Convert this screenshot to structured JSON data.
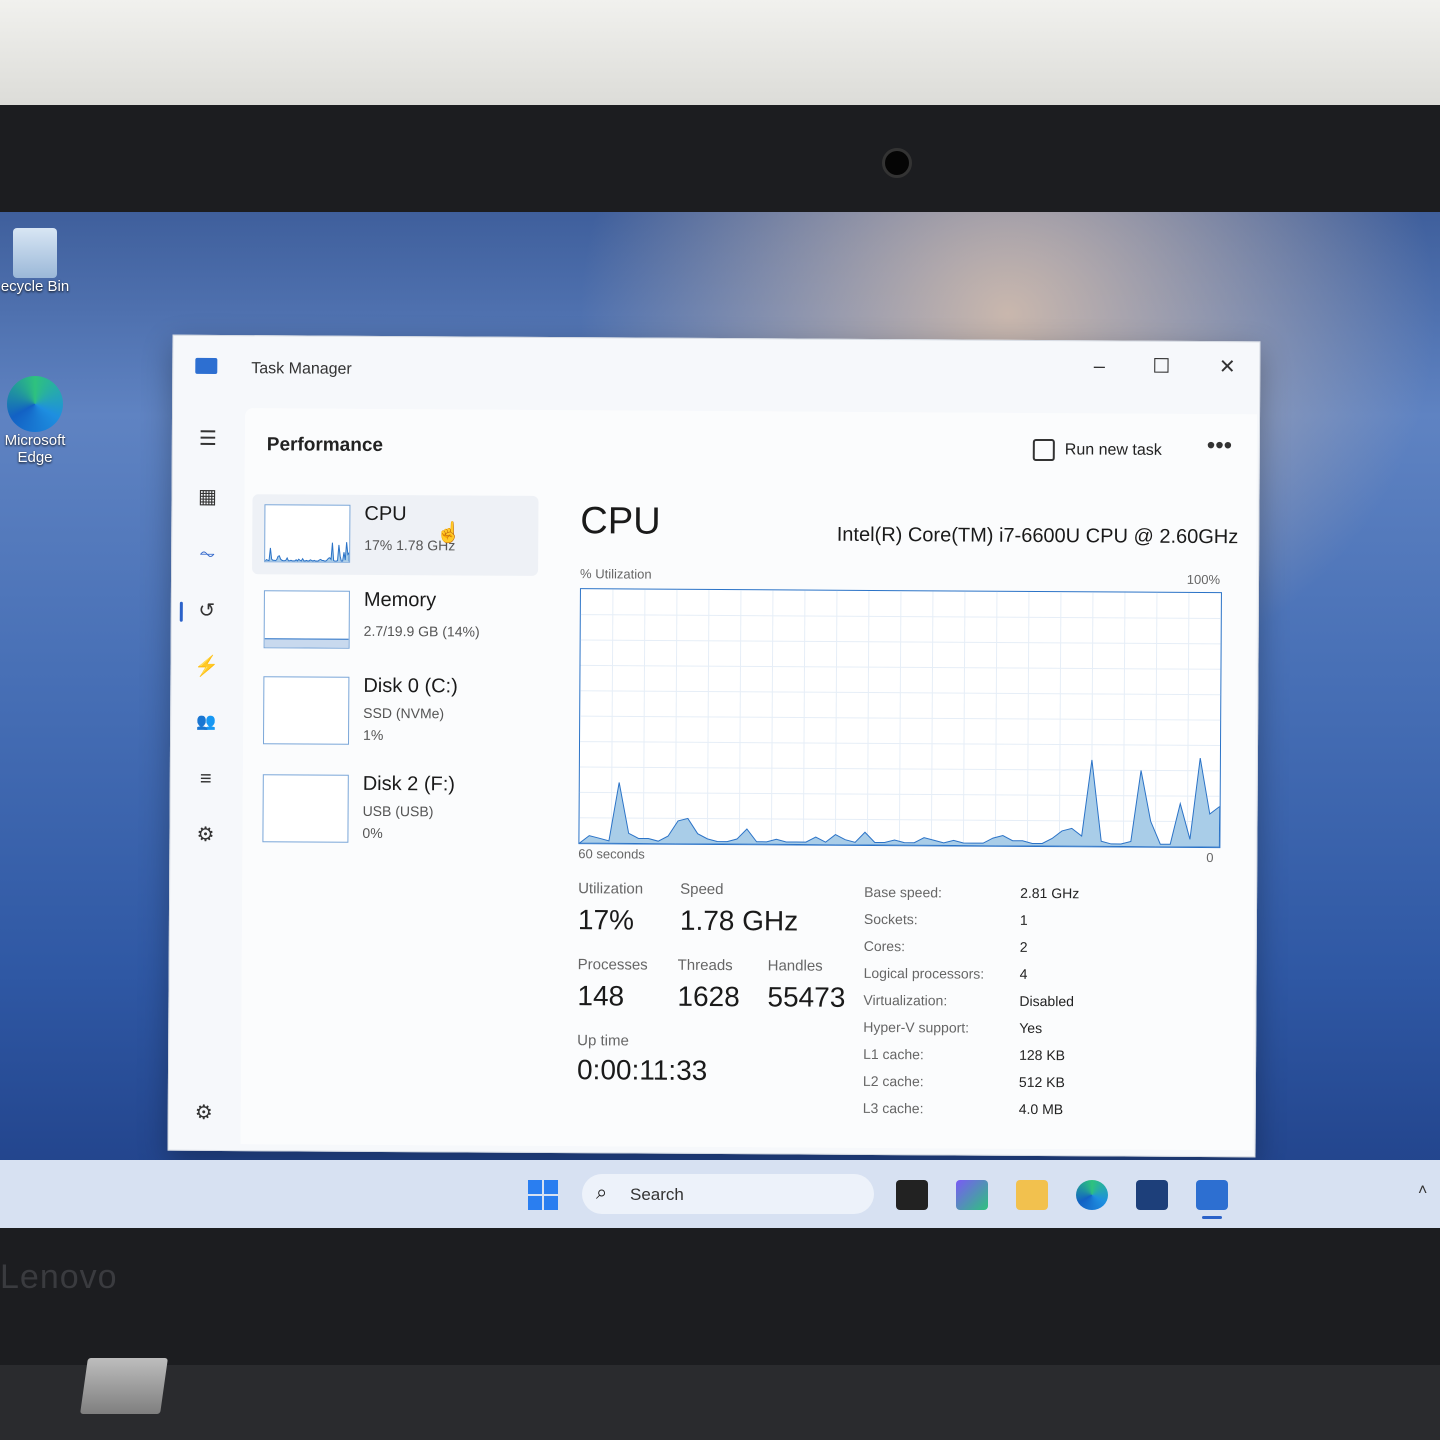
{
  "desktop": {
    "recycle_bin_label": "ecycle Bin",
    "edge_label_1": "Microsoft",
    "edge_label_2": "Edge"
  },
  "laptop": {
    "brand": "Lenovo"
  },
  "window": {
    "title": "Task Manager",
    "page_title": "Performance",
    "run_new_task": "Run new task",
    "more": "•••",
    "minimize": "–",
    "maximize": "☐",
    "close": "✕"
  },
  "nav": [
    {
      "name": "menu-icon",
      "glyph": "☰"
    },
    {
      "name": "processes-icon",
      "glyph": "▦"
    },
    {
      "name": "performance-icon",
      "glyph": "⏦"
    },
    {
      "name": "app-history-icon",
      "glyph": "↺"
    },
    {
      "name": "startup-apps-icon",
      "glyph": "⚡"
    },
    {
      "name": "users-icon",
      "glyph": "👥"
    },
    {
      "name": "details-icon",
      "glyph": "≡"
    },
    {
      "name": "services-icon",
      "glyph": "⚙"
    },
    {
      "name": "settings-icon",
      "glyph": "⚙"
    }
  ],
  "devices": [
    {
      "name": "CPU",
      "sub1": "17%  1.78 GHz",
      "sub2": ""
    },
    {
      "name": "Memory",
      "sub1": "2.7/19.9 GB (14%)",
      "sub2": ""
    },
    {
      "name": "Disk 0 (C:)",
      "sub1": "SSD (NVMe)",
      "sub2": "1%"
    },
    {
      "name": "Disk 2 (F:)",
      "sub1": "USB (USB)",
      "sub2": "0%"
    }
  ],
  "cpu": {
    "heading": "CPU",
    "model": "Intel(R) Core(TM) i7-6600U CPU @ 2.60GHz",
    "util_label": "% Utilization",
    "max_label": "100%",
    "time_label": "60 seconds",
    "zero_label": "0",
    "utilization_label": "Utilization",
    "utilization": "17%",
    "speed_label": "Speed",
    "speed": "1.78 GHz",
    "processes_label": "Processes",
    "processes": "148",
    "threads_label": "Threads",
    "threads": "1628",
    "handles_label": "Handles",
    "handles": "55473",
    "uptime_label": "Up time",
    "uptime": "0:00:11:33",
    "details": [
      {
        "k": "Base speed:",
        "v": "2.81 GHz"
      },
      {
        "k": "Sockets:",
        "v": "1"
      },
      {
        "k": "Cores:",
        "v": "2"
      },
      {
        "k": "Logical processors:",
        "v": "4"
      },
      {
        "k": "Virtualization:",
        "v": "Disabled"
      },
      {
        "k": "Hyper-V support:",
        "v": "Yes"
      },
      {
        "k": "L1 cache:",
        "v": "128 KB"
      },
      {
        "k": "L2 cache:",
        "v": "512 KB"
      },
      {
        "k": "L3 cache:",
        "v": "4.0 MB"
      }
    ]
  },
  "cpu_history_percent": [
    0,
    3,
    2,
    1,
    24,
    4,
    2,
    2,
    1,
    3,
    9,
    10,
    4,
    2,
    1,
    1,
    2,
    6,
    1,
    1,
    2,
    1,
    1,
    1,
    3,
    1,
    4,
    2,
    1,
    5,
    1,
    1,
    2,
    1,
    1,
    3,
    2,
    1,
    2,
    1,
    1,
    1,
    3,
    4,
    2,
    2,
    1,
    1,
    3,
    6,
    7,
    4,
    34,
    2,
    1,
    1,
    2,
    30,
    10,
    1,
    1,
    17,
    3,
    35,
    13,
    16
  ],
  "taskbar": {
    "search": "Search"
  },
  "colors": {
    "accent": "#2b73c7",
    "graph_fill": "#a9cde8"
  }
}
